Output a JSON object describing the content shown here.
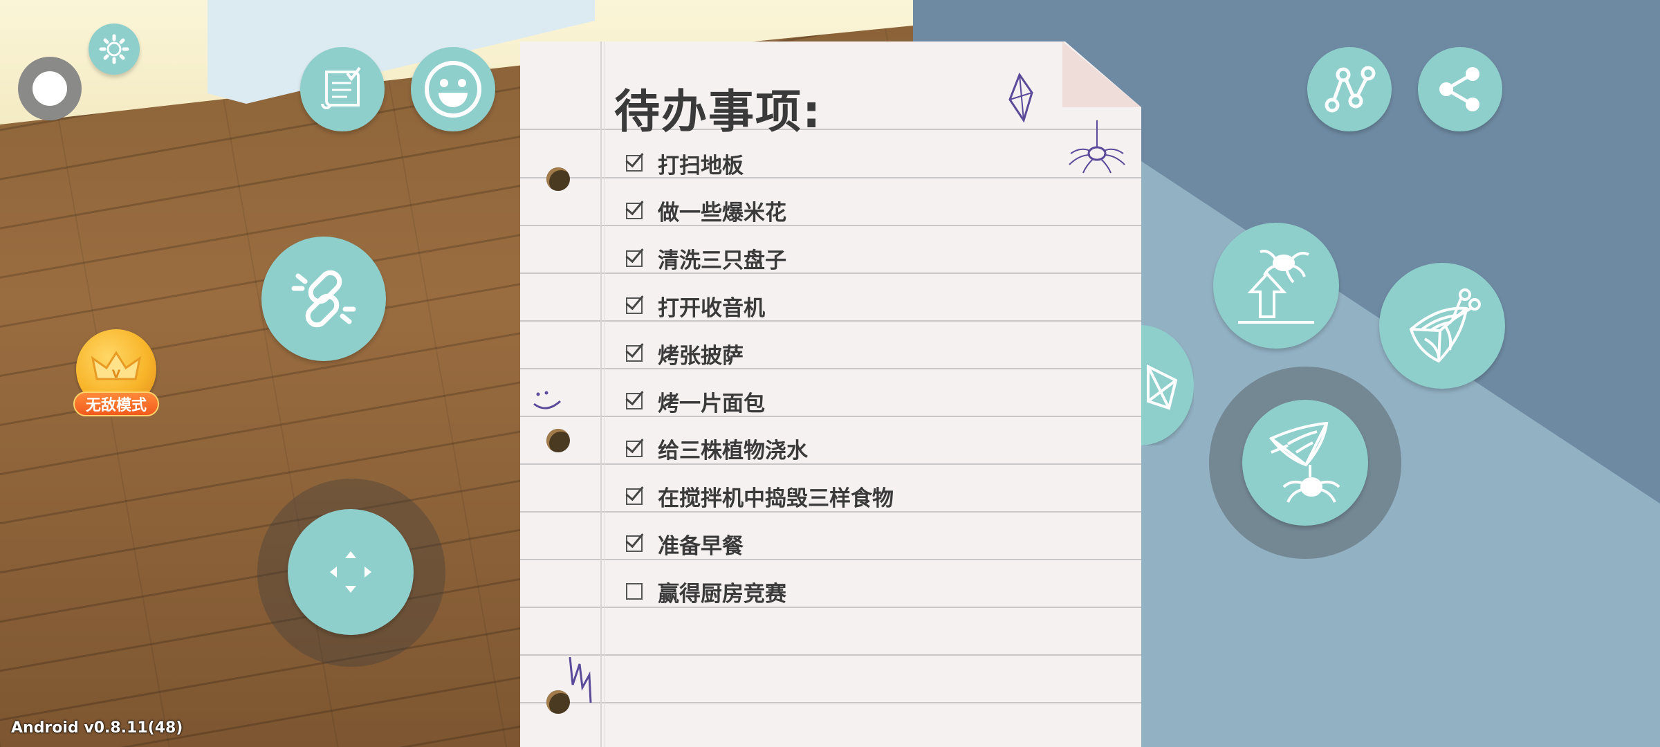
{
  "note": {
    "title": "待办事项:",
    "tasks": [
      {
        "label": "打扫地板",
        "done": true
      },
      {
        "label": "做一些爆米花",
        "done": true
      },
      {
        "label": "清洗三只盘子",
        "done": true
      },
      {
        "label": "打开收音机",
        "done": true
      },
      {
        "label": "烤张披萨",
        "done": true
      },
      {
        "label": "烤一片面包",
        "done": true
      },
      {
        "label": "给三株植物浇水",
        "done": true
      },
      {
        "label": "在搅拌机中捣毁三样食物",
        "done": true
      },
      {
        "label": "准备早餐",
        "done": true
      },
      {
        "label": "赢得厨房竞赛",
        "done": false
      }
    ]
  },
  "badge": {
    "label": "无敌模式"
  },
  "footer": {
    "version": "Android v0.8.11(48)"
  },
  "icons": {
    "settings": "gear-icon",
    "record": "record-icon",
    "tasks": "task-list-icon",
    "emote": "smiley-icon",
    "link": "chain-link-icon",
    "move": "dpad-icon",
    "network": "network-icon",
    "share": "share-icon",
    "web_climb": "spider-climb-icon",
    "web_cut": "web-cut-icon",
    "web_spider": "web-spider-icon",
    "web_partial": "web-icon"
  },
  "colors": {
    "button": "#8ecfcc",
    "paper": "#f5f1f1",
    "ink": "#3a3a3a",
    "badge": "#f8b52a"
  }
}
